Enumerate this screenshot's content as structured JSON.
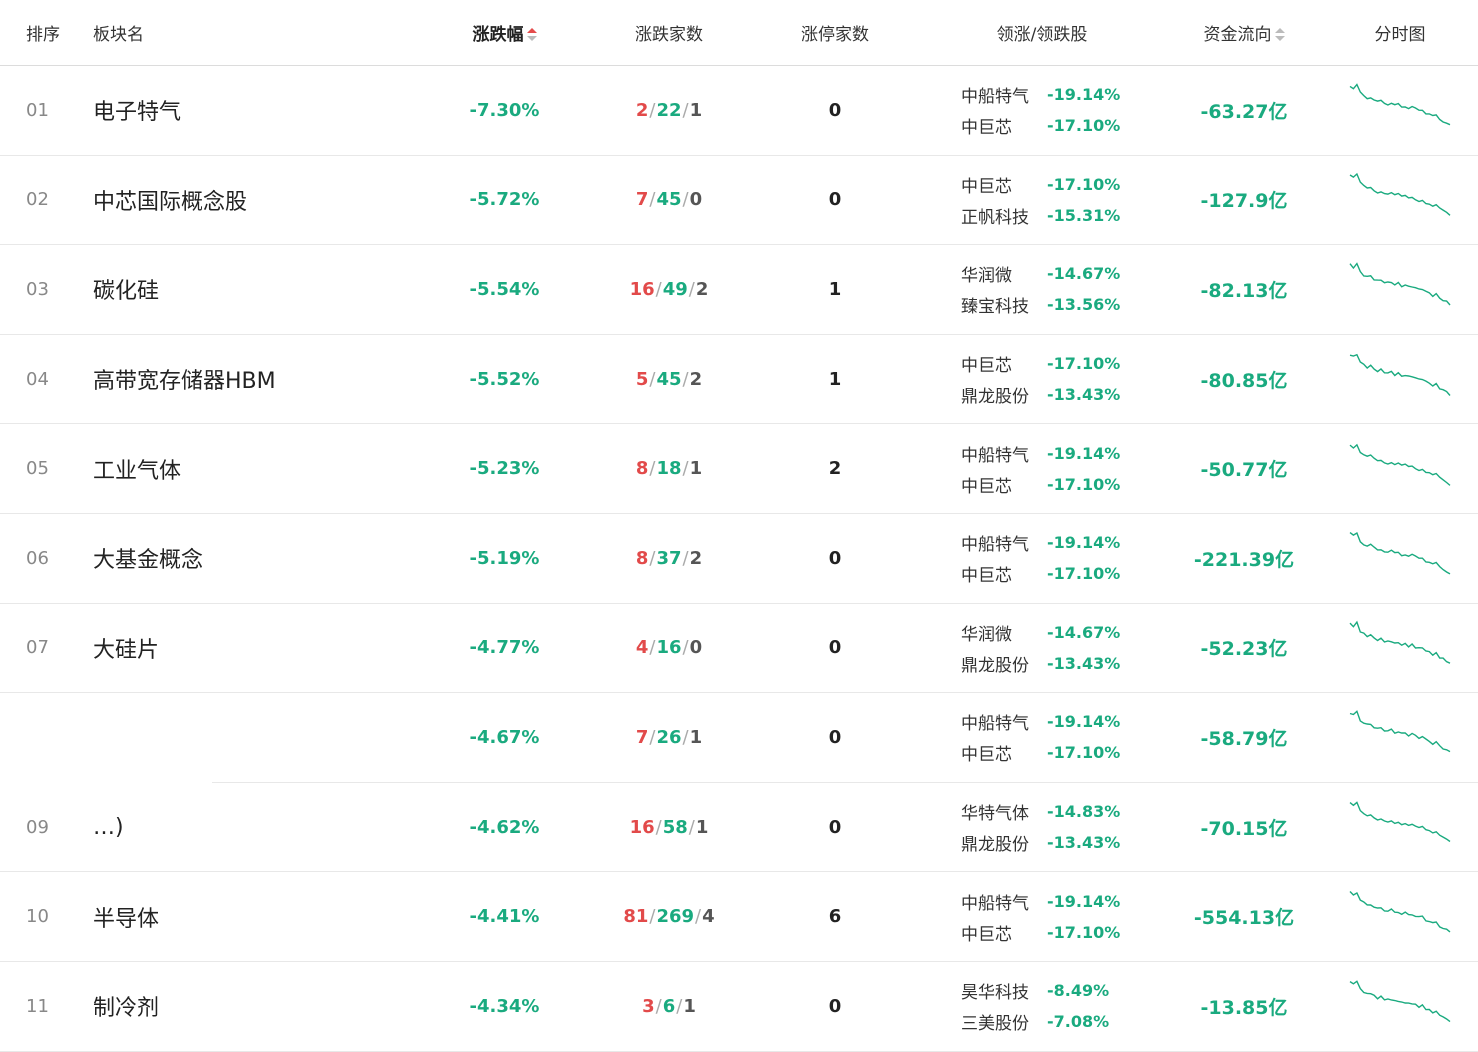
{
  "header": {
    "rank": "排序",
    "name": "板块名",
    "pct": "涨跌幅",
    "updown": "涨跌家数",
    "limitup": "涨停家数",
    "leaders": "领涨/领跌股",
    "flow": "资金流向",
    "chart": "分时图"
  },
  "rows": [
    {
      "rank": "01",
      "name": "电子特气",
      "pct": "-7.30%",
      "up": "2",
      "down": "22",
      "flat": "1",
      "limit": "0",
      "leaders": [
        {
          "name": "中船特气",
          "pct": "-19.14%"
        },
        {
          "name": "中巨芯",
          "pct": "-17.10%"
        }
      ],
      "flow": "-63.27亿"
    },
    {
      "rank": "02",
      "name": "中芯国际概念股",
      "pct": "-5.72%",
      "up": "7",
      "down": "45",
      "flat": "0",
      "limit": "0",
      "leaders": [
        {
          "name": "中巨芯",
          "pct": "-17.10%"
        },
        {
          "name": "正帆科技",
          "pct": "-15.31%"
        }
      ],
      "flow": "-127.9亿"
    },
    {
      "rank": "03",
      "name": "碳化硅",
      "pct": "-5.54%",
      "up": "16",
      "down": "49",
      "flat": "2",
      "limit": "1",
      "leaders": [
        {
          "name": "华润微",
          "pct": "-14.67%"
        },
        {
          "name": "臻宝科技",
          "pct": "-13.56%"
        }
      ],
      "flow": "-82.13亿"
    },
    {
      "rank": "04",
      "name": "高带宽存储器HBM",
      "pct": "-5.52%",
      "up": "5",
      "down": "45",
      "flat": "2",
      "limit": "1",
      "leaders": [
        {
          "name": "中巨芯",
          "pct": "-17.10%"
        },
        {
          "name": "鼎龙股份",
          "pct": "-13.43%"
        }
      ],
      "flow": "-80.85亿"
    },
    {
      "rank": "05",
      "name": "工业气体",
      "pct": "-5.23%",
      "up": "8",
      "down": "18",
      "flat": "1",
      "limit": "2",
      "leaders": [
        {
          "name": "中船特气",
          "pct": "-19.14%"
        },
        {
          "name": "中巨芯",
          "pct": "-17.10%"
        }
      ],
      "flow": "-50.77亿"
    },
    {
      "rank": "06",
      "name": "大基金概念",
      "pct": "-5.19%",
      "up": "8",
      "down": "37",
      "flat": "2",
      "limit": "0",
      "leaders": [
        {
          "name": "中船特气",
          "pct": "-19.14%"
        },
        {
          "name": "中巨芯",
          "pct": "-17.10%"
        }
      ],
      "flow": "-221.39亿"
    },
    {
      "rank": "07",
      "name": "大硅片",
      "pct": "-4.77%",
      "up": "4",
      "down": "16",
      "flat": "0",
      "limit": "0",
      "leaders": [
        {
          "name": "华润微",
          "pct": "-14.67%"
        },
        {
          "name": "鼎龙股份",
          "pct": "-13.43%"
        }
      ],
      "flow": "-52.23亿"
    },
    {
      "rank": "",
      "name": "",
      "pct": "-4.67%",
      "up": "7",
      "down": "26",
      "flat": "1",
      "limit": "0",
      "leaders": [
        {
          "name": "中船特气",
          "pct": "-19.14%"
        },
        {
          "name": "中巨芯",
          "pct": "-17.10%"
        }
      ],
      "flow": "-58.79亿"
    },
    {
      "rank": "09",
      "name": "…)",
      "pct": "-4.62%",
      "up": "16",
      "down": "58",
      "flat": "1",
      "limit": "0",
      "leaders": [
        {
          "name": "华特气体",
          "pct": "-14.83%"
        },
        {
          "name": "鼎龙股份",
          "pct": "-13.43%"
        }
      ],
      "flow": "-70.15亿"
    },
    {
      "rank": "10",
      "name": "半导体",
      "pct": "-4.41%",
      "up": "81",
      "down": "269",
      "flat": "4",
      "limit": "6",
      "leaders": [
        {
          "name": "中船特气",
          "pct": "-19.14%"
        },
        {
          "name": "中巨芯",
          "pct": "-17.10%"
        }
      ],
      "flow": "-554.13亿"
    },
    {
      "rank": "11",
      "name": "制冷剂",
      "pct": "-4.34%",
      "up": "3",
      "down": "6",
      "flat": "1",
      "limit": "0",
      "leaders": [
        {
          "name": "昊华科技",
          "pct": "-8.49%"
        },
        {
          "name": "三美股份",
          "pct": "-7.08%"
        }
      ],
      "flow": "-13.85亿"
    }
  ],
  "colors": {
    "down": "#1aaa7f",
    "up": "#e24a4a",
    "sort_active": "#e44b4b"
  },
  "sparkline": [
    0.95,
    0.9,
    0.96,
    0.8,
    0.74,
    0.7,
    0.72,
    0.66,
    0.62,
    0.64,
    0.6,
    0.58,
    0.6,
    0.55,
    0.57,
    0.52,
    0.54,
    0.5,
    0.52,
    0.48,
    0.45,
    0.47,
    0.4,
    0.38,
    0.33,
    0.35,
    0.28,
    0.24,
    0.2,
    0.15
  ]
}
